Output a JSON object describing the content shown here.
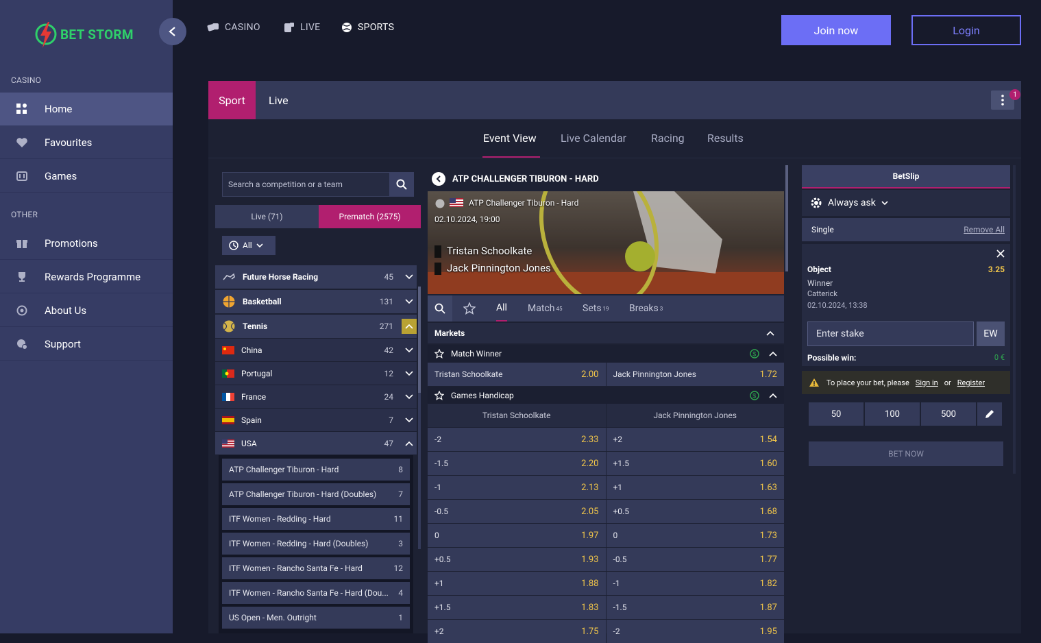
{
  "brand": {
    "name": "BET STORM"
  },
  "sidebar": {
    "sections": [
      {
        "heading": "CASINO",
        "items": [
          {
            "label": "Home",
            "icon": "grid-icon",
            "active": true
          },
          {
            "label": "Favourites",
            "icon": "heart-icon"
          },
          {
            "label": "Games",
            "icon": "slot-icon"
          }
        ]
      },
      {
        "heading": "OTHER",
        "items": [
          {
            "label": "Promotions",
            "icon": "gift-icon"
          },
          {
            "label": "Rewards Programme",
            "icon": "trophy-icon"
          },
          {
            "label": "About Us",
            "icon": "info-icon"
          },
          {
            "label": "Support",
            "icon": "support-icon"
          }
        ]
      }
    ]
  },
  "topnav": {
    "casino": "CASINO",
    "live": "LIVE",
    "sports": "SPORTS",
    "join": "Join now",
    "login": "Login"
  },
  "tabs": {
    "sport": "Sport",
    "live": "Live",
    "badge": "1"
  },
  "subnav": [
    "Event View",
    "Live Calendar",
    "Racing",
    "Results"
  ],
  "left": {
    "search_placeholder": "Search a competition or a team",
    "seg_live": "Live (71)",
    "seg_prematch": "Prematch (2575)",
    "filter": "All",
    "sports": [
      {
        "name": "Future Horse Racing",
        "count": "45"
      },
      {
        "name": "Basketball",
        "count": "131"
      },
      {
        "name": "Tennis",
        "count": "271"
      }
    ],
    "countries": [
      {
        "name": "China",
        "count": "42"
      },
      {
        "name": "Portugal",
        "count": "12"
      },
      {
        "name": "France",
        "count": "24"
      },
      {
        "name": "Spain",
        "count": "7"
      },
      {
        "name": "USA",
        "count": "47"
      }
    ],
    "competitions": [
      {
        "name": "ATP Challenger Tiburon - Hard",
        "count": "8"
      },
      {
        "name": "ATP Challenger Tiburon - Hard (Doubles)",
        "count": "7"
      },
      {
        "name": "ITF Women - Redding - Hard",
        "count": "11"
      },
      {
        "name": "ITF Women - Redding - Hard (Doubles)",
        "count": "3"
      },
      {
        "name": "ITF Women - Rancho Santa Fe - Hard",
        "count": "12"
      },
      {
        "name": "ITF Women - Rancho Santa Fe - Hard (Dou...",
        "count": "4"
      },
      {
        "name": "US Open - Men. Outright",
        "count": "1"
      }
    ]
  },
  "event": {
    "title": "ATP CHALLENGER TIBURON - HARD",
    "competition": "ATP Challenger Tiburon - Hard",
    "date": "02.10.2024, 19:00",
    "player1": "Tristan Schoolkate",
    "player2": "Jack Pinnington Jones",
    "tabs": [
      {
        "label": "All",
        "sup": ""
      },
      {
        "label": "Match",
        "sup": "45"
      },
      {
        "label": "Sets",
        "sup": "19"
      },
      {
        "label": "Breaks",
        "sup": "3"
      }
    ],
    "markets_label": "Markets",
    "match_winner": {
      "title": "Match Winner",
      "home": "Tristan Schoolkate",
      "home_odds": "2.00",
      "away": "Jack Pinnington Jones",
      "away_odds": "1.72"
    },
    "handicap": {
      "title": "Games Handicap",
      "col1": "Tristan Schoolkate",
      "col2": "Jack Pinnington Jones",
      "rows": [
        [
          "-2",
          "2.33",
          "+2",
          "1.54"
        ],
        [
          "-1.5",
          "2.20",
          "+1.5",
          "1.60"
        ],
        [
          "-1",
          "2.13",
          "+1",
          "1.63"
        ],
        [
          "-0.5",
          "2.05",
          "+0.5",
          "1.68"
        ],
        [
          "0",
          "1.97",
          "0",
          "1.73"
        ],
        [
          "+0.5",
          "1.93",
          "-0.5",
          "1.77"
        ],
        [
          "+1",
          "1.88",
          "-1",
          "1.82"
        ],
        [
          "+1.5",
          "1.83",
          "-1.5",
          "1.87"
        ],
        [
          "+2",
          "1.75",
          "-2",
          "1.95"
        ]
      ]
    }
  },
  "betslip": {
    "title": "BetSlip",
    "always_ask": "Always ask",
    "single": "Single",
    "remove_all": "Remove All",
    "selection": "Object",
    "odds": "3.25",
    "market": "Winner",
    "event": "Catterick",
    "time": "02.10.2024, 13:38",
    "stake_placeholder": "Enter stake",
    "ew": "EW",
    "possible_win_label": "Possible win:",
    "possible_win": "0 €",
    "warn_prefix": "To place your bet, please",
    "sign_in": "Sign in",
    "or": "or",
    "register": "Register",
    "chips": [
      "50",
      "100",
      "500"
    ],
    "bet_now": "BET NOW"
  },
  "colors": {
    "accent": "#b11f6f",
    "brand_green": "#2fd06a",
    "join": "#6c6ef5",
    "odds": "#f4c84a"
  }
}
